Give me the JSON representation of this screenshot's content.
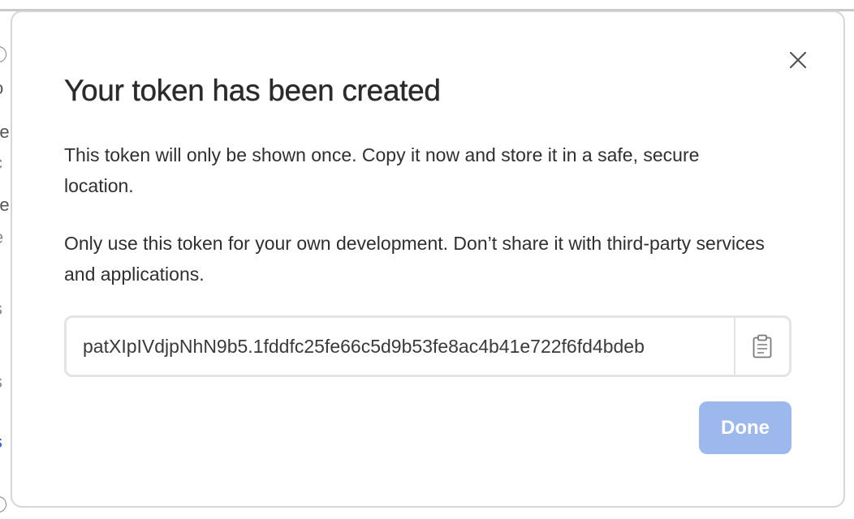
{
  "background": {
    "fragments": [
      "o",
      "re",
      "c",
      "re",
      "e",
      ".",
      "s",
      ".",
      "s",
      "s"
    ]
  },
  "modal": {
    "title": "Your token has been created",
    "paragraph_1": "This token will only be shown once. Copy it now and store it in a safe, secure location.",
    "paragraph_2": "Only use this token for your own development. Don’t share it with third-party services and applications.",
    "token_value": "patXIpIVdjpNhN9b5.1fddfc25fe66c5d9b53fe8ac4b41e722f6fd4bdeb",
    "done_label": "Done",
    "close_icon": "close-icon",
    "copy_icon": "clipboard-icon"
  },
  "colors": {
    "done_button": "#9db8ec",
    "link": "#2f5fd0"
  }
}
